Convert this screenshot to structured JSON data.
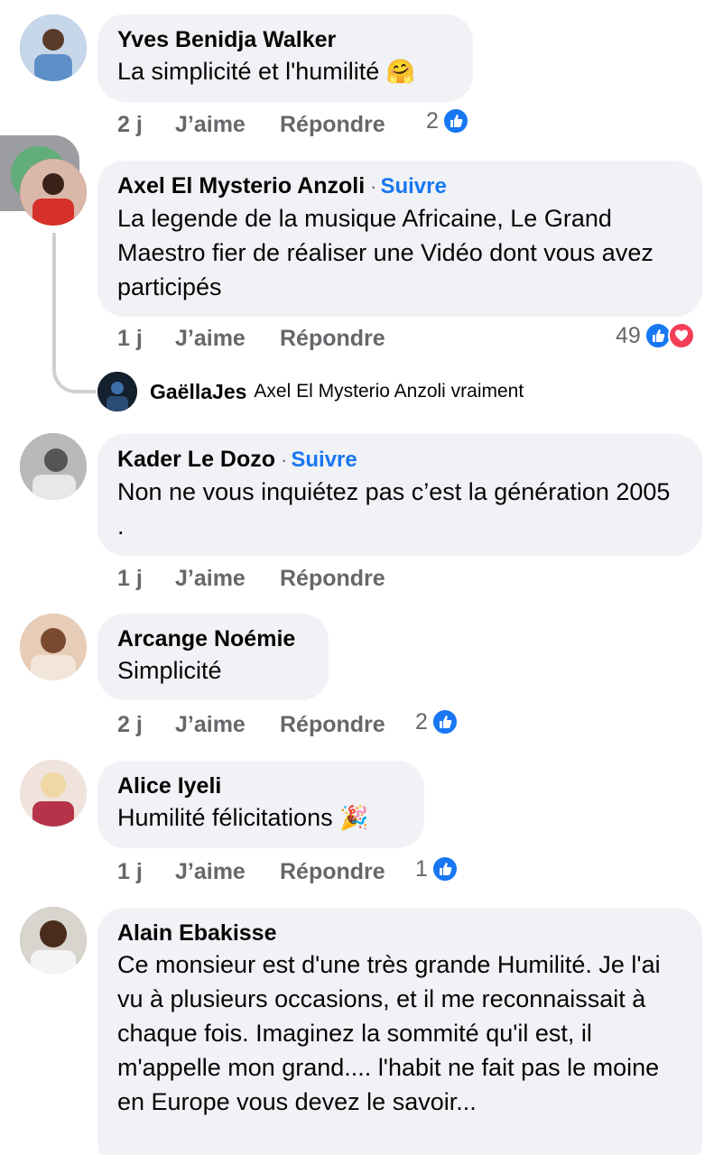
{
  "actions": {
    "like": "J’aime",
    "reply": "Répondre"
  },
  "comments": [
    {
      "author": "Yves Benidja Walker",
      "follow": "",
      "text": "La simplicité et l'humilité",
      "emoji": "🤗",
      "time": "2 j",
      "reactions": "2"
    },
    {
      "author": "Axel El Mysterio Anzoli",
      "follow": "Suivre",
      "text": "La legende de la musique Africaine, Le Grand Maestro fier de réaliser une Vidéo dont vous avez participés",
      "emoji": "",
      "time": "1 j",
      "reactions": "49"
    },
    {
      "author": "Kader Le Dozo",
      "follow": "Suivre",
      "text": "Non ne vous inquiétez pas c’est la génération 2005 .",
      "emoji": "",
      "time": "1 j",
      "reactions": ""
    },
    {
      "author": "Arcange Noémie",
      "follow": "",
      "text": "Simplicité",
      "emoji": "",
      "time": "2 j",
      "reactions": "2"
    },
    {
      "author": "Alice Iyeli",
      "follow": "",
      "text": "Humilité félicitations",
      "emoji": "🎉",
      "time": "1 j",
      "reactions": "1"
    },
    {
      "author": "Alain Ebakisse",
      "follow": "",
      "text": "Ce monsieur est d'une très grande Humilité. Je l'ai vu à plusieurs occasions, et il me reconnaissait à chaque fois. Imaginez la sommité qu'il est, il m'appelle mon grand.... l'habit ne fait pas le moine en Europe vous devez le savoir...",
      "emoji": "",
      "time": "",
      "reactions": ""
    }
  ],
  "reply": {
    "author": "GaëllaJes",
    "text": "Axel El Mysterio Anzoli vraiment"
  },
  "separator": "·",
  "colors": {
    "bubble": "#f0f2f5",
    "link": "#1877f2",
    "meta": "#65676b",
    "like": "#1877f2",
    "love": "#f33e58"
  }
}
